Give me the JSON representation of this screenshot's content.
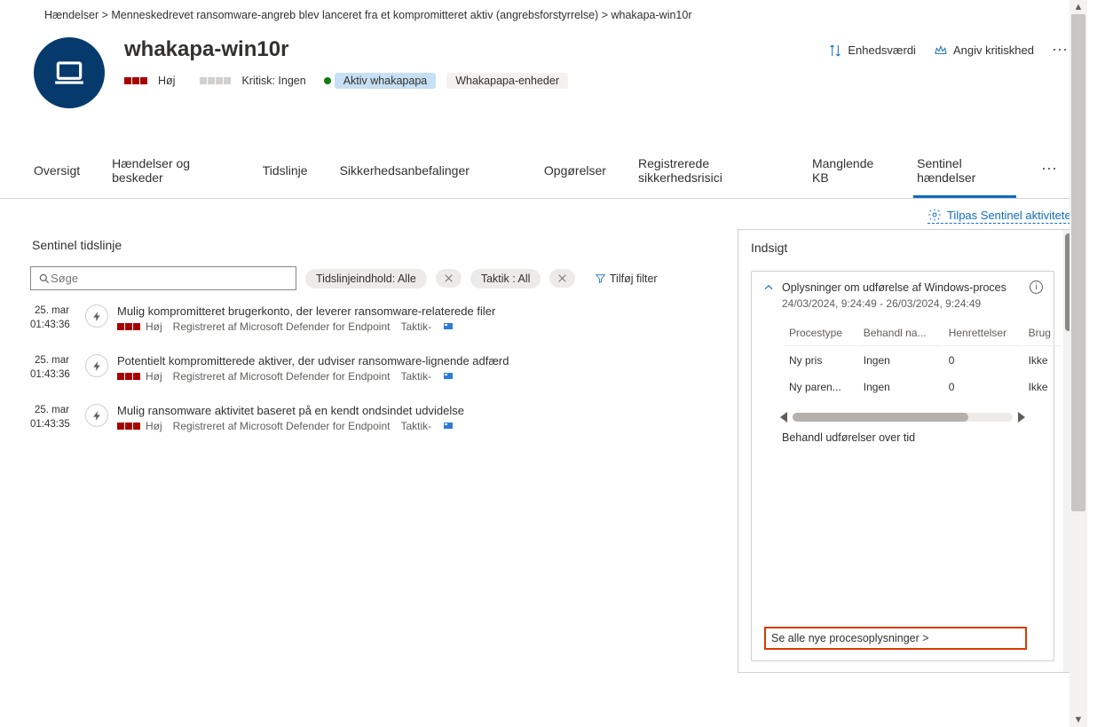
{
  "breadcrumb": "Hændelser &gt;   Menneskedrevet ransomware-angreb blev lanceret fra et kompromitteret aktiv (angrebsforstyrrelse) &gt; whakapa-win10r",
  "header": {
    "title": "whakapa-win10r",
    "severity_label": "Høj",
    "criticality": "Kritisk: Ingen",
    "active_pill": "Aktiv whakapapa",
    "group_pill": "Whakapapa-enheder",
    "device_value": "Enhedsværdi",
    "criticality_action": "Angiv kritiskhed"
  },
  "tabs": {
    "t0": "Oversigt",
    "t1": "Hændelser og beskeder",
    "t2": "Tidslinje",
    "t3": "Sikkerhedsanbefalinger",
    "t4": "Opgørelser",
    "t5": "Registrerede sikkerhedsrisici",
    "t6": "Manglende KB",
    "t7": "Sentinel hændelser"
  },
  "toolbar": {
    "customize": "Tilpas Sentinel aktiviteter"
  },
  "timeline": {
    "heading": "Sentinel tidslinje",
    "search_placeholder": "Søge",
    "chip1": "Tidslinjeindhold: Alle",
    "chip2_key": "Taktik",
    "chip2_val": ": All",
    "add_filter": "Tilføj filter",
    "registered_by": "Registreret af Microsoft Defender for Endpoint",
    "tactic_prefix": "Taktik-",
    "items": [
      {
        "date": "25. mar",
        "time": "01:43:36",
        "title": "Mulig kompromitteret brugerkonto, der leverer ransomware-relaterede filer",
        "sev": "Høj"
      },
      {
        "date": "25. mar",
        "time": "01:43:36",
        "title": "Potentielt kompromitterede aktiver, der udviser ransomware-lignende adfærd",
        "sev": "Høj"
      },
      {
        "date": "25. mar",
        "time": "01:43:35",
        "title": "Mulig ransomware aktivitet baseret på en kendt ondsindet udvidelse",
        "sev": "Høj"
      }
    ]
  },
  "insights": {
    "heading": "Indsigt",
    "card_title": "Oplysninger om udførelse af Windows-proces",
    "date_range": "24/03/2024, 9:24:49 - 26/03/2024, 9:24:49",
    "cols": {
      "c0": "Procestype",
      "c1": "Behandl na...",
      "c2": "Henrettelser",
      "c3": "Brug"
    },
    "rows": [
      {
        "c0": "Ny pris",
        "c1": "Ingen",
        "c2": "0",
        "c3": "Ikke"
      },
      {
        "c0": "Ny paren...",
        "c1": "Ingen",
        "c2": "0",
        "c3": "Ikke"
      }
    ],
    "subheading": "Behandl udførelser over tid",
    "footer": "Se alle nye procesoplysninger &gt;"
  }
}
